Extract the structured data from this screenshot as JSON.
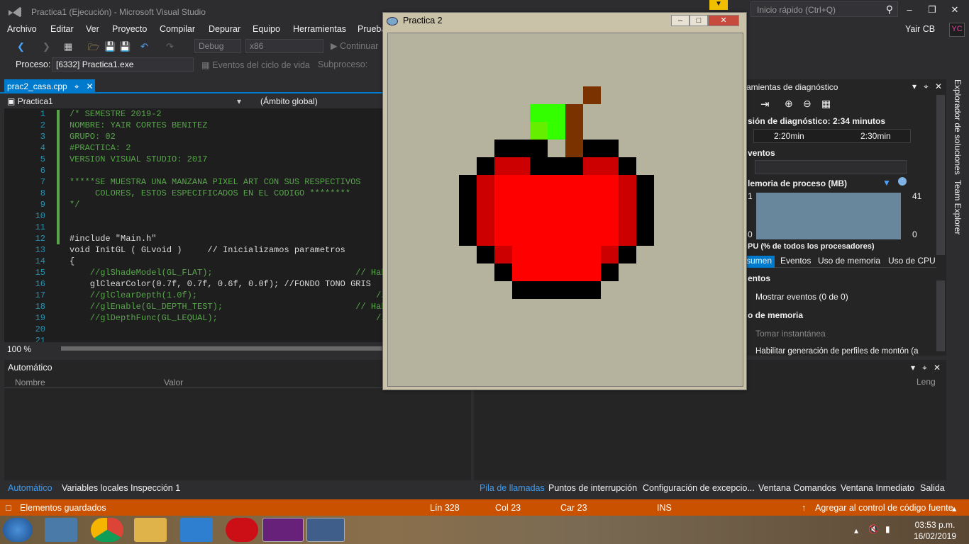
{
  "titlebar": {
    "title": "Practica1 (Ejecución) - Microsoft Visual Studio",
    "quick_launch": "Inicio rápido (Ctrl+Q)"
  },
  "menu": [
    "Archivo",
    "Editar",
    "Ver",
    "Proyecto",
    "Compilar",
    "Depurar",
    "Equipo",
    "Herramientas",
    "Prueba"
  ],
  "user": {
    "name": "Yair CB",
    "badge": "YC"
  },
  "toolbar": {
    "config": "Debug",
    "platform": "x86",
    "continue": "Continuar"
  },
  "toolbar2": {
    "process_label": "Proceso:",
    "process_value": "[6332] Practica1.exe",
    "lifecycle": "Eventos del ciclo de vida",
    "thread": "Subproceso:"
  },
  "editor": {
    "tab": "prac2_casa.cpp",
    "project": "Practica1",
    "scope": "(Ámbito global)",
    "zoom": "100 %",
    "lines": [
      {
        "n": "1",
        "text": "/* SEMESTRE 2019-2",
        "cls": "cm"
      },
      {
        "n": "2",
        "text": "NOMBRE: YAIR CORTES BENITEZ",
        "cls": "cm"
      },
      {
        "n": "3",
        "text": "GRUPO: 02",
        "cls": "cm"
      },
      {
        "n": "4",
        "text": "#PRACTICA: 2",
        "cls": "cm"
      },
      {
        "n": "5",
        "text": "VERSION VISUAL STUDIO: 2017",
        "cls": "cm"
      },
      {
        "n": "6",
        "text": "",
        "cls": "cm"
      },
      {
        "n": "7",
        "text": "*****SE MUESTRA UNA MANZANA PIXEL ART CON SUS RESPECTIVOS",
        "cls": "cm"
      },
      {
        "n": "8",
        "text": "     COLORES, ESTOS ESPECIFICADOS EN EL CODIGO ********",
        "cls": "cm"
      },
      {
        "n": "9",
        "text": "*/",
        "cls": "cm"
      },
      {
        "n": "10",
        "text": "",
        "cls": ""
      },
      {
        "n": "11",
        "text": "",
        "cls": ""
      },
      {
        "n": "12",
        "text": "#include \"Main.h\"",
        "cls": ""
      },
      {
        "n": "13",
        "text": "void InitGL ( GLvoid )     // Inicializamos parametros",
        "cls": ""
      },
      {
        "n": "14",
        "text": "{",
        "cls": ""
      },
      {
        "n": "15",
        "text": "    //glShadeModel(GL_FLAT);                            // Habi",
        "cls": "cm"
      },
      {
        "n": "16",
        "text": "    glClearColor(0.7f, 0.7f, 0.6f, 0.0f); //FONDO TONO GRIS",
        "cls": ""
      },
      {
        "n": "17",
        "text": "    //glClearDepth(1.0f);                                   //",
        "cls": "cm"
      },
      {
        "n": "18",
        "text": "    //glEnable(GL_DEPTH_TEST);                          // Habi",
        "cls": "cm"
      },
      {
        "n": "19",
        "text": "    //glDepthFunc(GL_LEQUAL);                               //",
        "cls": "cm"
      },
      {
        "n": "20",
        "text": "",
        "cls": ""
      },
      {
        "n": "21",
        "text": "",
        "cls": ""
      }
    ]
  },
  "auto_window": {
    "title": "Automático",
    "col_name": "Nombre",
    "col_value": "Valor"
  },
  "diagnostics": {
    "title": "ramientas de diagnóstico",
    "session": "sión de diagnóstico: 2:34 minutos",
    "tick1": "2:20min",
    "tick2": "2:30min",
    "events": "ventos",
    "memory": "lemoria de proceso (MB)",
    "mem_max": "41",
    "mem_min": "0",
    "mem_left_top": "1",
    "mem_left_bot": "0",
    "cpu": "PU (% de todos los procesadores)",
    "tabs": [
      "sumen",
      "Eventos",
      "Uso de memoria",
      "Uso de CPU"
    ],
    "sec_events": "entos",
    "show_events": "Mostrar eventos (0 de 0)",
    "sec_memory": "o de memoria",
    "snapshot": "Tomar instantánea",
    "heap": "Habilitar generación de perfiles de montón (a"
  },
  "callstack": {
    "col": "Leng"
  },
  "sidebar": {
    "solutions": "Explorador de soluciones",
    "team": "Team Explorer"
  },
  "bottom_tabs_left": [
    "Automático",
    "Variables locales",
    "Inspección 1"
  ],
  "bottom_tabs_right": [
    "Pila de llamadas",
    "Puntos de interrupción",
    "Configuración de excepcio...",
    "Ventana Comandos",
    "Ventana Inmediato",
    "Salida"
  ],
  "status": {
    "msg": "Elementos guardados",
    "line": "Lín 328",
    "col": "Col 23",
    "car": "Car 23",
    "ins": "INS",
    "source": "Agregar al control de código fuente"
  },
  "taskbar": {
    "time": "03:53 p.m.",
    "date": "16/02/2019"
  },
  "gl_window": {
    "title": "Practica 2"
  },
  "apple_colors": {
    "black": "#000000",
    "dark_red": "#cc0000",
    "red": "#ff0000",
    "green": "#33ff00",
    "light_green": "#66ee00",
    "brown": "#7a3300",
    "bg": "#b5b39e"
  }
}
